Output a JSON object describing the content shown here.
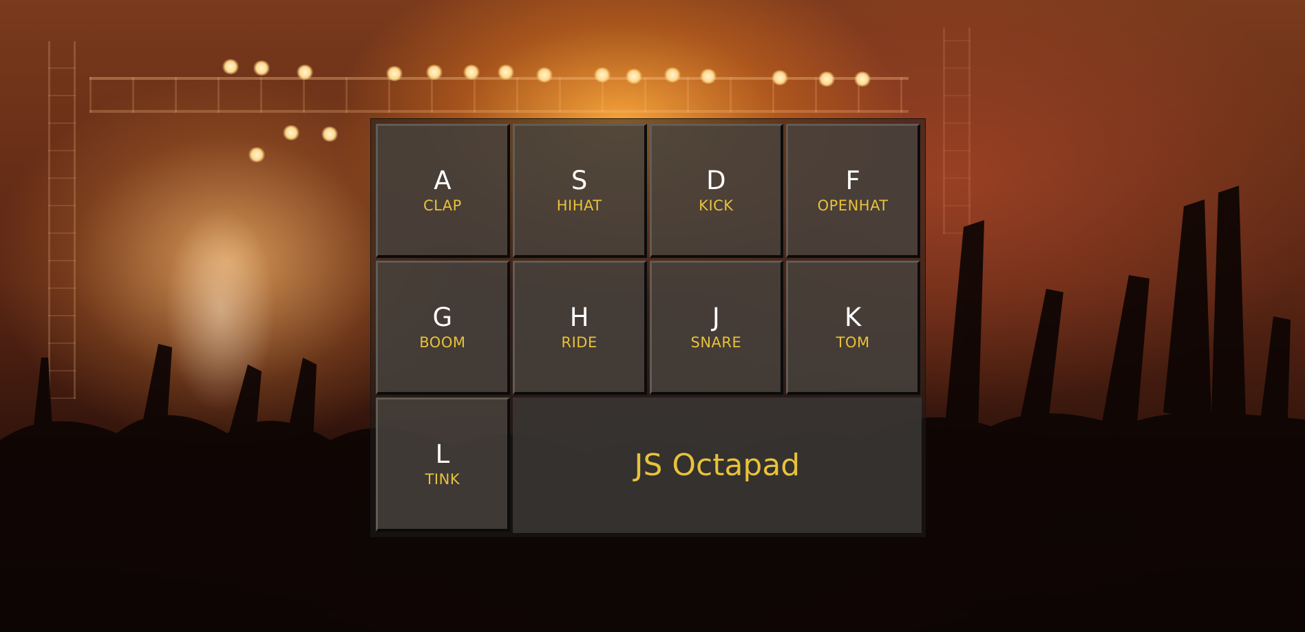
{
  "octapad": {
    "title": "JS Octapad",
    "pads": [
      {
        "key": "A",
        "sound": "CLAP"
      },
      {
        "key": "S",
        "sound": "HIHAT"
      },
      {
        "key": "D",
        "sound": "KICK"
      },
      {
        "key": "F",
        "sound": "OPENHAT"
      },
      {
        "key": "G",
        "sound": "BOOM"
      },
      {
        "key": "H",
        "sound": "RIDE"
      },
      {
        "key": "J",
        "sound": "SNARE"
      },
      {
        "key": "K",
        "sound": "TOM"
      },
      {
        "key": "L",
        "sound": "TINK"
      }
    ]
  },
  "colors": {
    "accent": "#e8c23a",
    "key_text": "#ffffff",
    "pad_background": "#48443e",
    "pad_shadow": "#0b0b0b"
  },
  "background": {
    "icon": "concert-crowd-image"
  }
}
